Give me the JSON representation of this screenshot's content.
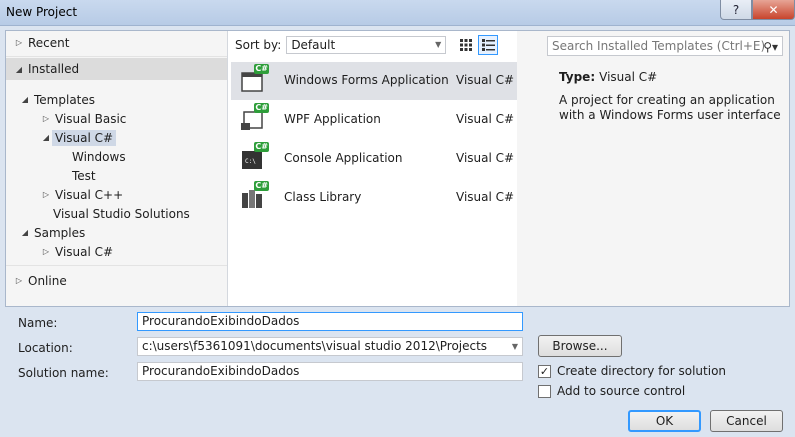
{
  "window": {
    "title": "New Project",
    "help_label": "?",
    "close_label": "✕"
  },
  "tree": {
    "recent": "Recent",
    "installed": "Installed",
    "templates": "Templates",
    "visual_basic": "Visual Basic",
    "visual_csharp": "Visual C#",
    "windows": "Windows",
    "test": "Test",
    "visual_cpp": "Visual C++",
    "vs_solutions": "Visual Studio Solutions",
    "samples": "Samples",
    "samples_csharp": "Visual C#",
    "online": "Online"
  },
  "sort": {
    "label": "Sort by:",
    "value": "Default"
  },
  "templates": [
    {
      "name": "Windows Forms Application",
      "lang": "Visual C#"
    },
    {
      "name": "WPF Application",
      "lang": "Visual C#"
    },
    {
      "name": "Console Application",
      "lang": "Visual C#"
    },
    {
      "name": "Class Library",
      "lang": "Visual C#"
    }
  ],
  "search": {
    "placeholder": "Search Installed Templates (Ctrl+E)"
  },
  "details": {
    "type_label": "Type:",
    "type_value": "Visual C#",
    "description": "A project for creating an application with a Windows Forms user interface"
  },
  "form": {
    "name_label": "Name:",
    "name_value": "ProcurandoExibindoDados",
    "location_label": "Location:",
    "location_value": "c:\\users\\f5361091\\documents\\visual studio 2012\\Projects",
    "solution_label": "Solution name:",
    "solution_value": "ProcurandoExibindoDados",
    "browse": "Browse...",
    "create_dir": "Create directory for solution",
    "add_source": "Add to source control",
    "ok": "OK",
    "cancel": "Cancel"
  },
  "badge": "C#",
  "colors": {
    "accent": "#3399ff",
    "close": "#c8442c",
    "badge": "#2e9e3a"
  }
}
